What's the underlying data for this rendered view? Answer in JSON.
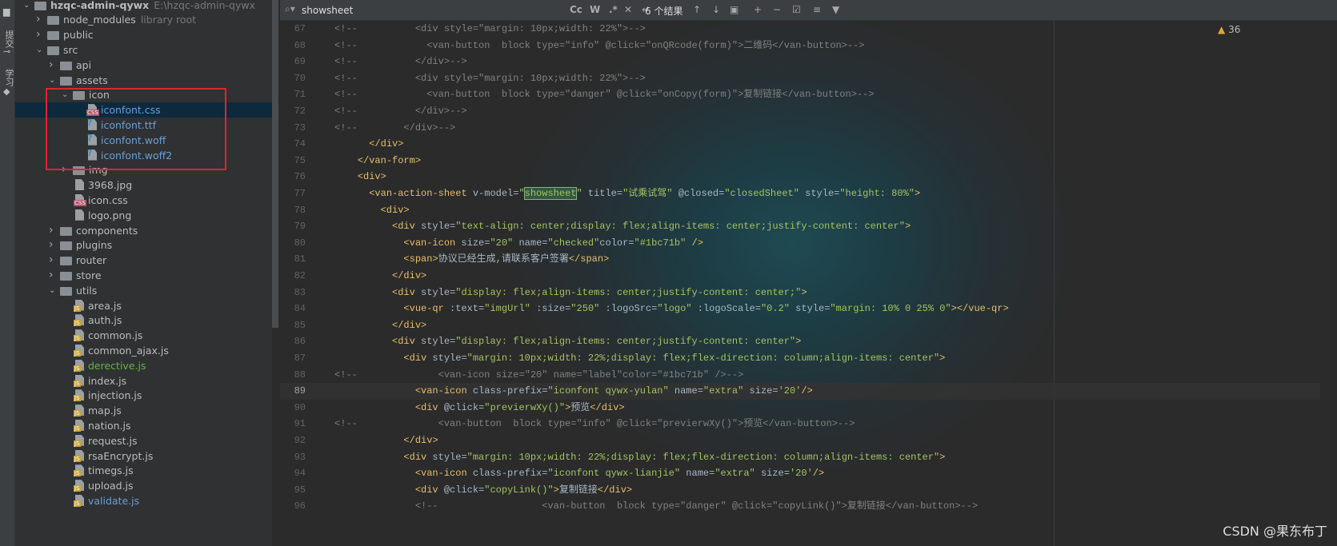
{
  "sidebar_strip": {
    "commit_label": "提交",
    "learn_label": "学习"
  },
  "project_tree": [
    {
      "name": "hzqc-admin-qywx",
      "extra": "E:\\hzqc-admin-qywx",
      "depth": 0,
      "type": "folder",
      "expanded": true,
      "bold": true
    },
    {
      "name": "node_modules",
      "extra": "library root",
      "depth": 1,
      "type": "folder",
      "expanded": false
    },
    {
      "name": "public",
      "depth": 1,
      "type": "folder",
      "expanded": false
    },
    {
      "name": "src",
      "depth": 1,
      "type": "folder",
      "expanded": true
    },
    {
      "name": "api",
      "depth": 2,
      "type": "folder",
      "expanded": false
    },
    {
      "name": "assets",
      "depth": 2,
      "type": "folder",
      "expanded": true
    },
    {
      "name": "icon",
      "depth": 3,
      "type": "folder",
      "expanded": true
    },
    {
      "name": "iconfont.css",
      "depth": 4,
      "type": "file",
      "badge": "CSS",
      "color": "#6a9fd8",
      "selected": true
    },
    {
      "name": "iconfont.ttf",
      "depth": 4,
      "type": "file",
      "badge": "?",
      "color": "#6a9fd8"
    },
    {
      "name": "iconfont.woff",
      "depth": 4,
      "type": "file",
      "badge": "?",
      "color": "#6a9fd8"
    },
    {
      "name": "iconfont.woff2",
      "depth": 4,
      "type": "file",
      "badge": "?",
      "color": "#6a9fd8"
    },
    {
      "name": "img",
      "depth": 3,
      "type": "folder",
      "expanded": false
    },
    {
      "name": "3968.jpg",
      "depth": 3,
      "type": "file"
    },
    {
      "name": "icon.css",
      "depth": 3,
      "type": "file",
      "badge": "CSS"
    },
    {
      "name": "logo.png",
      "depth": 3,
      "type": "file"
    },
    {
      "name": "components",
      "depth": 2,
      "type": "folder",
      "expanded": false
    },
    {
      "name": "plugins",
      "depth": 2,
      "type": "folder",
      "expanded": false
    },
    {
      "name": "router",
      "depth": 2,
      "type": "folder",
      "expanded": false
    },
    {
      "name": "store",
      "depth": 2,
      "type": "folder",
      "expanded": false
    },
    {
      "name": "utils",
      "depth": 2,
      "type": "folder",
      "expanded": true
    },
    {
      "name": "area.js",
      "depth": 3,
      "type": "file",
      "badge": "JS"
    },
    {
      "name": "auth.js",
      "depth": 3,
      "type": "file",
      "badge": "JS"
    },
    {
      "name": "common.js",
      "depth": 3,
      "type": "file",
      "badge": "JS"
    },
    {
      "name": "common_ajax.js",
      "depth": 3,
      "type": "file",
      "badge": "JS"
    },
    {
      "name": "derective.js",
      "depth": 3,
      "type": "file",
      "badge": "JS",
      "color": "#62b543"
    },
    {
      "name": "index.js",
      "depth": 3,
      "type": "file",
      "badge": "JS"
    },
    {
      "name": "injection.js",
      "depth": 3,
      "type": "file",
      "badge": "JS"
    },
    {
      "name": "map.js",
      "depth": 3,
      "type": "file",
      "badge": "JS"
    },
    {
      "name": "nation.js",
      "depth": 3,
      "type": "file",
      "badge": "JS"
    },
    {
      "name": "request.js",
      "depth": 3,
      "type": "file",
      "badge": "JS"
    },
    {
      "name": "rsaEncrypt.js",
      "depth": 3,
      "type": "file",
      "badge": "JS"
    },
    {
      "name": "timegs.js",
      "depth": 3,
      "type": "file",
      "badge": "JS"
    },
    {
      "name": "upload.js",
      "depth": 3,
      "type": "file",
      "badge": "JS"
    },
    {
      "name": "validate.js",
      "depth": 3,
      "type": "file",
      "badge": "JS",
      "color": "#6a9fd8"
    }
  ],
  "search": {
    "query": "showsheet",
    "match_case": "Cc",
    "words": "W",
    "regex": ".*",
    "result_count": "6 个结果"
  },
  "inspections": {
    "warnings": "36"
  },
  "current_line": 89,
  "search_match": "showsheet",
  "code_lines": [
    {
      "n": 67,
      "comment": true,
      "text": "<!--          <div style=\"margin: 10px;width: 22%\">-->"
    },
    {
      "n": 68,
      "comment": true,
      "text": "<!--            <van-button  block type=\"info\" @click=\"onQRcode(form)\">二维码</van-button>-->"
    },
    {
      "n": 69,
      "comment": true,
      "text": "<!--          </div>-->"
    },
    {
      "n": 70,
      "comment": true,
      "text": "<!--          <div style=\"margin: 10px;width: 22%\">-->"
    },
    {
      "n": 71,
      "comment": true,
      "text": "<!--            <van-button  block type=\"danger\" @click=\"onCopy(form)\">复制链接</van-button>-->"
    },
    {
      "n": 72,
      "comment": true,
      "text": "<!--          </div>-->"
    },
    {
      "n": 73,
      "comment": true,
      "text": "<!--        </div>-->"
    },
    {
      "n": 74,
      "text": "      </div>"
    },
    {
      "n": 75,
      "text": "    </van-form>"
    },
    {
      "n": 76,
      "text": "    <div>"
    },
    {
      "n": 77,
      "text": "      <van-action-sheet v-model=\"showsheet\" title=\"试乘试驾\" @closed=\"closedSheet\" style=\"height: 80%\">"
    },
    {
      "n": 78,
      "text": "        <div>"
    },
    {
      "n": 79,
      "text": "          <div style=\"text-align: center;display: flex;align-items: center;justify-content: center\">"
    },
    {
      "n": 80,
      "text": "            <van-icon size=\"20\" name=\"checked\"color=\"#1bc71b\" />"
    },
    {
      "n": 81,
      "text": "            <span>协议已经生成,请联系客户签署</span>"
    },
    {
      "n": 82,
      "text": "          </div>"
    },
    {
      "n": 83,
      "text": "          <div style=\"display: flex;align-items: center;justify-content: center;\">"
    },
    {
      "n": 84,
      "text": "            <vue-qr :text=\"imgUrl\" :size=\"250\" :logoSrc=\"logo\" :logoScale=\"0.2\" style=\"margin: 10% 0 25% 0\"></vue-qr>"
    },
    {
      "n": 85,
      "text": "          </div>"
    },
    {
      "n": 86,
      "text": "          <div style=\"display: flex;align-items: center;justify-content: center\">"
    },
    {
      "n": 87,
      "text": "            <div style=\"margin: 10px;width: 22%;display: flex;flex-direction: column;align-items: center\">"
    },
    {
      "n": 88,
      "comment": true,
      "text": "<!--              <van-icon size=\"20\" name=\"label\"color=\"#1bc71b\" />-->"
    },
    {
      "n": 89,
      "text": "              <van-icon class-prefix=\"iconfont qywx-yulan\" name=\"extra\" size='20'/>"
    },
    {
      "n": 90,
      "text": "              <div @click=\"previerwXy()\">预览</div>"
    },
    {
      "n": 91,
      "comment": true,
      "text": "<!--              <van-button  block type=\"info\" @click=\"previerwXy()\">预览</van-button>-->"
    },
    {
      "n": 92,
      "text": "            </div>"
    },
    {
      "n": 93,
      "text": "            <div style=\"margin: 10px;width: 22%;display: flex;flex-direction: column;align-items: center\">"
    },
    {
      "n": 94,
      "text": "              <van-icon class-prefix=\"iconfont qywx-lianjie\" name=\"extra\" size='20'/>"
    },
    {
      "n": 95,
      "text": "              <div @click=\"copyLink()\">复制链接</div>"
    },
    {
      "n": 96,
      "comment": true,
      "text": "              <!--                  <van-button  block type=\"danger\" @click=\"copyLink()\">复制链接</van-button>-->"
    }
  ],
  "watermark": "CSDN @果东布丁"
}
